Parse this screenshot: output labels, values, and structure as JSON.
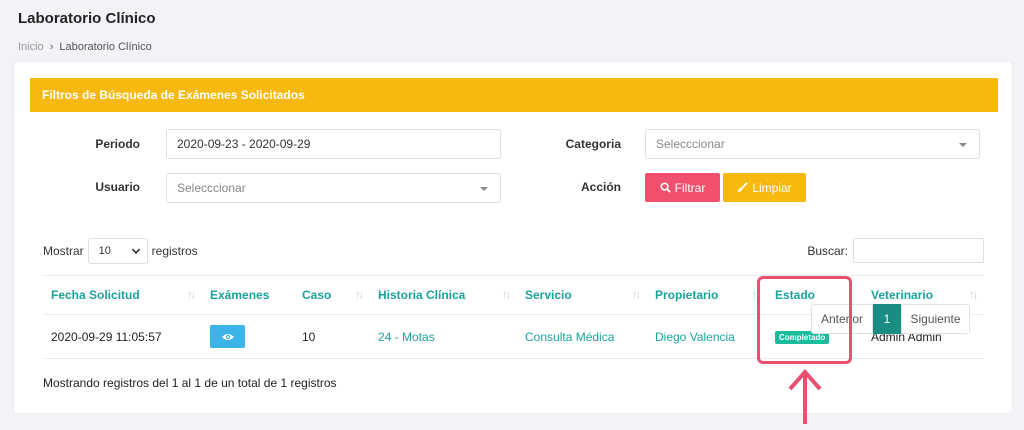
{
  "page": {
    "title": "Laboratorio Clínico",
    "breadcrumb": {
      "home": "Inicio",
      "separator": "›",
      "current": "Laboratorio Clínico"
    }
  },
  "filters": {
    "header": "Filtros de Búsqueda de Exámenes Solicitados",
    "periodo_label": "Periodo",
    "periodo_value": "2020-09-23 - 2020-09-29",
    "categoria_label": "Categoria",
    "categoria_placeholder": "Selecccionar",
    "usuario_label": "Usuario",
    "usuario_placeholder": "Selecccionar",
    "accion_label": "Acción",
    "filtrar_label": "Filtrar",
    "limpiar_label": "Limpiar"
  },
  "table_controls": {
    "show_label": "Mostrar",
    "page_length": "10",
    "records_label": "registros",
    "search_label": "Buscar:"
  },
  "table": {
    "columns": [
      "Fecha Solicitud",
      "Exámenes",
      "Caso",
      "Historia Clínica",
      "Servicio",
      "Propietario",
      "Estado",
      "Veterinario"
    ],
    "rows": [
      {
        "fecha": "2020-09-29 11:05:57",
        "caso": "10",
        "historia": "24 - Motas",
        "servicio": "Consulta Médica",
        "propietario": "Diego Valencia",
        "estado": "Completado",
        "veterinario": "Admin Admin"
      }
    ]
  },
  "footer": {
    "info": "Mostrando registros del 1 al 1 de un total de 1 registros",
    "prev": "Anterior",
    "current_page": "1",
    "next": "Siguiente"
  },
  "colors": {
    "accent_yellow": "#f7b90f",
    "teal": "#1aa39a",
    "filter_button": "#f0506e",
    "badge": "#1abc9c",
    "annotation": "#e94f6f"
  },
  "icons": [
    "search-icon",
    "brush-icon",
    "eye-icon",
    "chevron-down-icon",
    "sort-icon",
    "arrow-up-icon"
  ]
}
